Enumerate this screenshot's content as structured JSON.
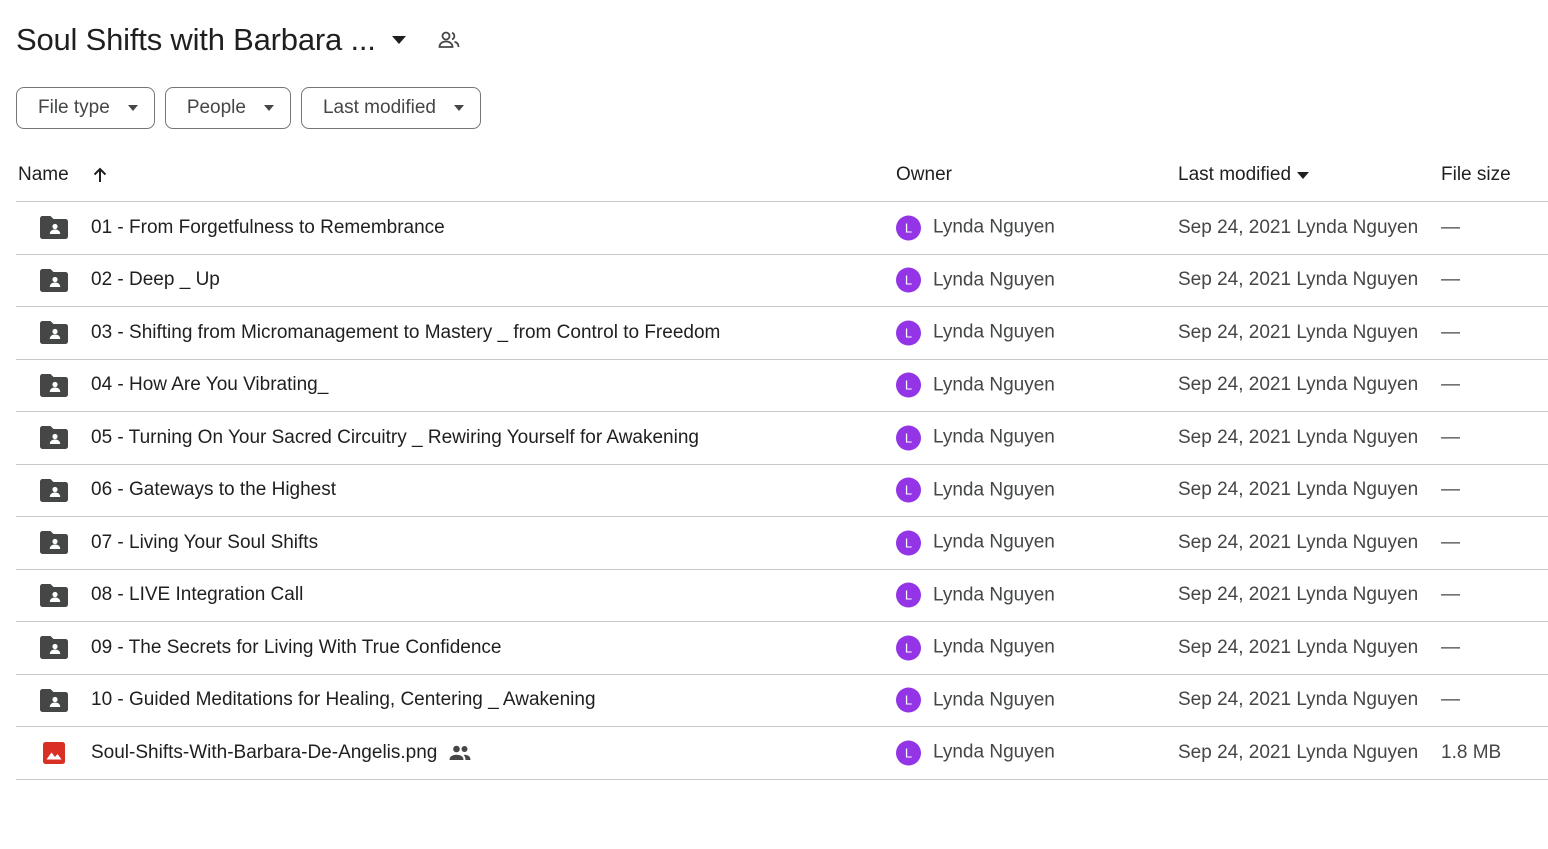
{
  "header": {
    "title": "Soul Shifts with Barbara ...",
    "caret_icon": "arrow-drop-down-icon",
    "shared_icon": "people-icon"
  },
  "filters": [
    {
      "label": "File type"
    },
    {
      "label": "People"
    },
    {
      "label": "Last modified"
    }
  ],
  "table": {
    "columns": {
      "name": "Name",
      "owner": "Owner",
      "last_modified": "Last modified",
      "file_size": "File size"
    },
    "rows": [
      {
        "type": "shared-folder",
        "name": "01 -  From Forgetfulness to Remembrance",
        "owner_initial": "L",
        "owner": "Lynda Nguyen",
        "modified": "Sep 24, 2021 Lynda Nguyen",
        "size": "—"
      },
      {
        "type": "shared-folder",
        "name": "02 -  Deep _ Up",
        "owner_initial": "L",
        "owner": "Lynda Nguyen",
        "modified": "Sep 24, 2021 Lynda Nguyen",
        "size": "—"
      },
      {
        "type": "shared-folder",
        "name": "03 -  Shifting from Micromanagement to Mastery _ from Control to Freedom",
        "owner_initial": "L",
        "owner": "Lynda Nguyen",
        "modified": "Sep 24, 2021 Lynda Nguyen",
        "size": "—"
      },
      {
        "type": "shared-folder",
        "name": "04 -  How Are You Vibrating_",
        "owner_initial": "L",
        "owner": "Lynda Nguyen",
        "modified": "Sep 24, 2021 Lynda Nguyen",
        "size": "—"
      },
      {
        "type": "shared-folder",
        "name": "05 -  Turning On Your Sacred Circuitry _ Rewiring Yourself for Awakening",
        "owner_initial": "L",
        "owner": "Lynda Nguyen",
        "modified": "Sep 24, 2021 Lynda Nguyen",
        "size": "—"
      },
      {
        "type": "shared-folder",
        "name": "06 -  Gateways to the Highest",
        "owner_initial": "L",
        "owner": "Lynda Nguyen",
        "modified": "Sep 24, 2021 Lynda Nguyen",
        "size": "—"
      },
      {
        "type": "shared-folder",
        "name": "07 -  Living Your Soul Shifts",
        "owner_initial": "L",
        "owner": "Lynda Nguyen",
        "modified": "Sep 24, 2021 Lynda Nguyen",
        "size": "—"
      },
      {
        "type": "shared-folder",
        "name": "08 - LIVE Integration Call",
        "owner_initial": "L",
        "owner": "Lynda Nguyen",
        "modified": "Sep 24, 2021 Lynda Nguyen",
        "size": "—"
      },
      {
        "type": "shared-folder",
        "name": "09 - The Secrets for Living With True Confidence",
        "owner_initial": "L",
        "owner": "Lynda Nguyen",
        "modified": "Sep 24, 2021 Lynda Nguyen",
        "size": "—"
      },
      {
        "type": "shared-folder",
        "name": "10 -  Guided Meditations for Healing, Centering _ Awakening",
        "owner_initial": "L",
        "owner": "Lynda Nguyen",
        "modified": "Sep 24, 2021 Lynda Nguyen",
        "size": "—"
      },
      {
        "type": "image",
        "name": "Soul-Shifts-With-Barbara-De-Angelis.png",
        "shared": true,
        "owner_initial": "L",
        "owner": "Lynda Nguyen",
        "modified": "Sep 24, 2021 Lynda Nguyen",
        "size": "1.8 MB"
      }
    ]
  },
  "colors": {
    "avatar": "#9334e6",
    "folder_icon": "#444746",
    "image_icon": "#d93025",
    "divider": "#c7c7c7"
  }
}
